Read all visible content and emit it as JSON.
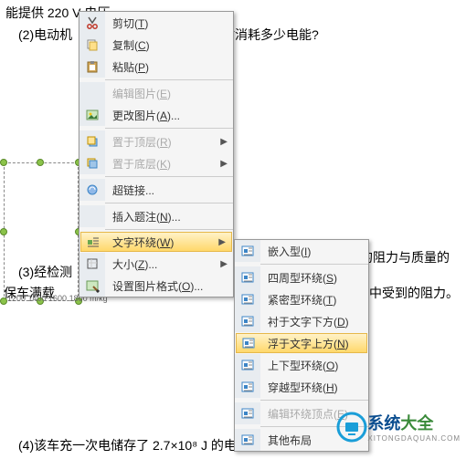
{
  "bg": {
    "line1a": "能提供 220 V 电压。",
    "line2a": "(2)电动机",
    "line2b": "时消耗多少电能?",
    "line3a": "(3)经检测",
    "line3b": "的阻力与质量的",
    "line4a": "保车满载",
    "line4b": "中受到的阻力。",
    "line5": "(4)该车充一次电储存了 2.7×10⁸ J 的电能",
    "axis": "1200 1400 1600 1800 m/kg"
  },
  "menu1": {
    "items": [
      {
        "label": "剪切(T)",
        "icon": "cut"
      },
      {
        "label": "复制(C)",
        "icon": "copy"
      },
      {
        "label": "粘贴(P)",
        "icon": "paste"
      },
      {
        "sep": true
      },
      {
        "label": "编辑图片(E)",
        "disabled": true
      },
      {
        "label": "更改图片(A)...",
        "icon": "change"
      },
      {
        "sep": true
      },
      {
        "label": "置于顶层(R)",
        "icon": "front",
        "arrow": true,
        "disabled": true
      },
      {
        "label": "置于底层(K)",
        "icon": "back",
        "arrow": true,
        "disabled": true
      },
      {
        "sep": true
      },
      {
        "label": "超链接...",
        "icon": "link"
      },
      {
        "sep": true
      },
      {
        "label": "插入题注(N)..."
      },
      {
        "sep": true
      },
      {
        "label": "文字环绕(W)",
        "icon": "wrap",
        "arrow": true,
        "highlight": true
      },
      {
        "label": "大小(Z)...",
        "icon": "size",
        "arrow": true
      },
      {
        "label": "设置图片格式(O)...",
        "icon": "format"
      }
    ]
  },
  "menu2": {
    "items": [
      {
        "label": "嵌入型(I)",
        "icon": "w"
      },
      {
        "sep": true
      },
      {
        "label": "四周型环绕(S)",
        "icon": "w"
      },
      {
        "label": "紧密型环绕(T)",
        "icon": "w"
      },
      {
        "label": "衬于文字下方(D)",
        "icon": "w"
      },
      {
        "label": "浮于文字上方(N)",
        "icon": "w",
        "highlight": true
      },
      {
        "label": "上下型环绕(O)",
        "icon": "w"
      },
      {
        "label": "穿越型环绕(H)",
        "icon": "w"
      },
      {
        "sep": true
      },
      {
        "label": "编辑环绕顶点(E)",
        "icon": "w",
        "disabled": true
      },
      {
        "sep": true
      },
      {
        "label": "其他布局",
        "icon": "w"
      }
    ]
  },
  "logo": {
    "t1": "系统",
    "t2": "大全",
    "sub": "XITONGDAQUAN.COM"
  },
  "chart_data": {
    "type": "line",
    "x": [
      1200,
      1400,
      1600,
      1800
    ],
    "xlabel": "m/kg",
    "note": "y-axis obscured by context menu"
  }
}
